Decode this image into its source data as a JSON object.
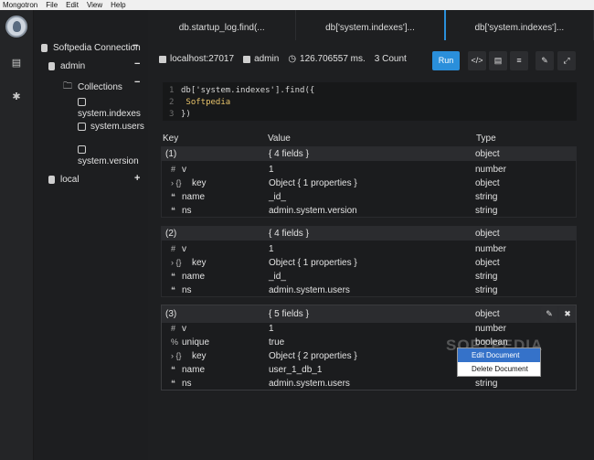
{
  "menubar": {
    "items": [
      "Mongotron",
      "File",
      "Edit",
      "View",
      "Help"
    ]
  },
  "sidebar": {
    "connection": "Softpedia Connection",
    "db_admin": "admin",
    "collections_label": "Collections",
    "collections": [
      "system.indexes",
      "system.users",
      "system.version"
    ],
    "db_local": "local",
    "minus": "−",
    "plus": "+"
  },
  "tabs": [
    {
      "label": "db.startup_log.find(..."
    },
    {
      "label": "db['system.indexes']..."
    },
    {
      "label": "db['system.indexes']..."
    }
  ],
  "info": {
    "host": "localhost:27017",
    "db": "admin",
    "time": "126.706557 ms.",
    "count": "3 Count"
  },
  "toolbar": {
    "run": "Run",
    "b1": "</>",
    "b2": "▤",
    "b3": "≡",
    "b4": "✎",
    "b5": "⤢"
  },
  "editor": {
    "lines": [
      {
        "n": "1",
        "text": "db['system.indexes'].find({"
      },
      {
        "n": "2",
        "text": " Softpedia"
      },
      {
        "n": "3",
        "text": "})"
      }
    ]
  },
  "columns": {
    "key": "Key",
    "value": "Value",
    "type": "Type"
  },
  "documents": [
    {
      "index": "(1)",
      "summary": "{ 4 fields }",
      "type": "object",
      "fields": [
        {
          "glyph": "#",
          "key": "v",
          "value": "1",
          "type": "number"
        },
        {
          "glyph": "› {}",
          "key": "key",
          "value": "Object { 1 properties }",
          "type": "object"
        },
        {
          "glyph": "❝",
          "key": "name",
          "value": "_id_",
          "type": "string"
        },
        {
          "glyph": "❝",
          "key": "ns",
          "value": "admin.system.version",
          "type": "string"
        }
      ]
    },
    {
      "index": "(2)",
      "summary": "{ 4 fields }",
      "type": "object",
      "fields": [
        {
          "glyph": "#",
          "key": "v",
          "value": "1",
          "type": "number"
        },
        {
          "glyph": "› {}",
          "key": "key",
          "value": "Object { 1 properties }",
          "type": "object"
        },
        {
          "glyph": "❝",
          "key": "name",
          "value": "_id_",
          "type": "string"
        },
        {
          "glyph": "❝",
          "key": "ns",
          "value": "admin.system.users",
          "type": "string"
        }
      ]
    },
    {
      "index": "(3)",
      "summary": "{ 5 fields }",
      "type": "object",
      "fields": [
        {
          "glyph": "#",
          "key": "v",
          "value": "1",
          "type": "number"
        },
        {
          "glyph": "%",
          "key": "unique",
          "value": "true",
          "type": "boolean"
        },
        {
          "glyph": "› {}",
          "key": "key",
          "value": "Object { 2 properties }",
          "type": "object"
        },
        {
          "glyph": "❝",
          "key": "name",
          "value": "user_1_db_1",
          "type": ""
        },
        {
          "glyph": "❝",
          "key": "ns",
          "value": "admin.system.users",
          "type": "string"
        }
      ]
    }
  ],
  "doc_actions": {
    "edit": "✎",
    "delete": "✖"
  },
  "context_menu": {
    "edit": "Edit Document",
    "delete": "Delete Document"
  },
  "watermark": "SOFTPEDIA"
}
